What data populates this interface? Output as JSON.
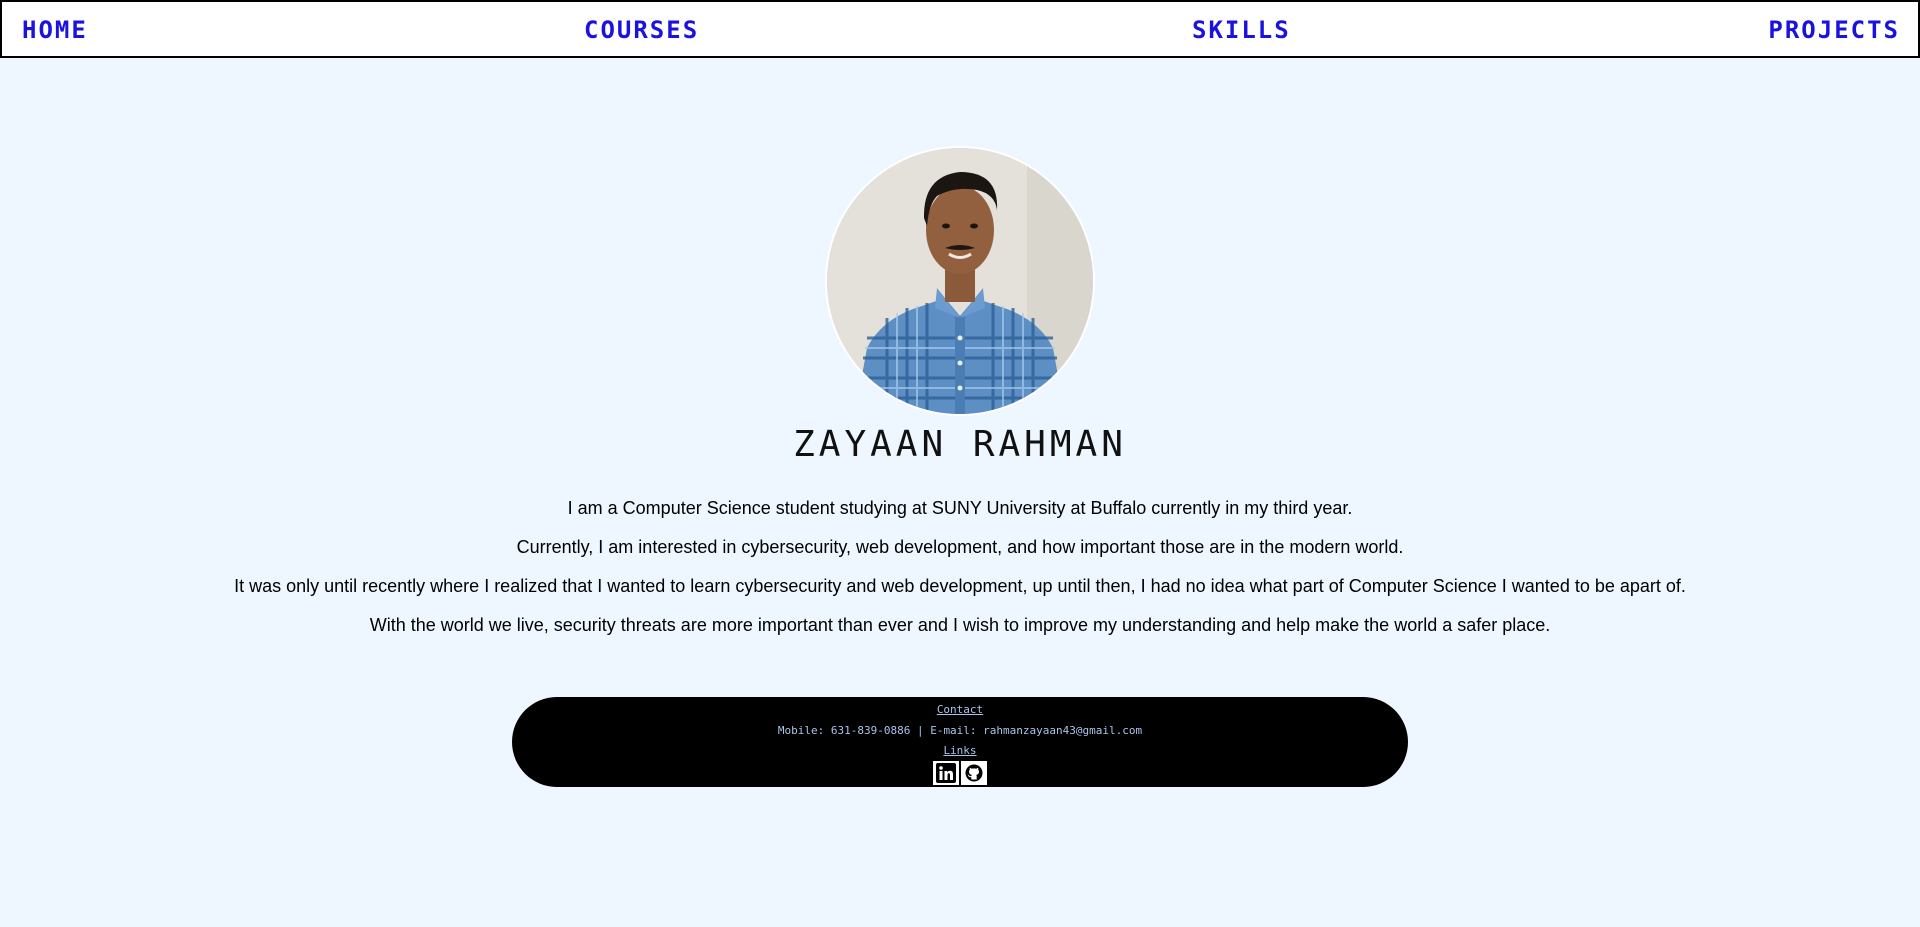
{
  "nav": {
    "home": "HOME",
    "courses": "COURSES",
    "skills": "SKILLS",
    "projects": "PROJECTS"
  },
  "profile": {
    "name": "ZAYAAN RAHMAN",
    "bio": [
      "I am a Computer Science student studying at SUNY University at Buffalo currently in my third year.",
      "Currently, I am interested in cybersecurity, web development, and how important those are in the modern world.",
      "It was only until recently where I realized that I wanted to learn cybersecurity and web development, up until then, I had no idea what part of Computer Science I wanted to be apart of.",
      "With the world we live, security threats are more important than ever and I wish to improve my understanding and help make the world a safer place."
    ]
  },
  "footer": {
    "contact_heading": "Contact",
    "contact_line": "Mobile: 631-839-0886 | E-mail: rahmanzayaan43@gmail.com",
    "links_heading": "Links",
    "icons": [
      "linkedin-icon",
      "github-icon"
    ]
  },
  "colors": {
    "background": "#eef6ff",
    "nav_link": "#1a13e0",
    "footer_bg": "#000000",
    "footer_text": "#a9c3e8"
  }
}
